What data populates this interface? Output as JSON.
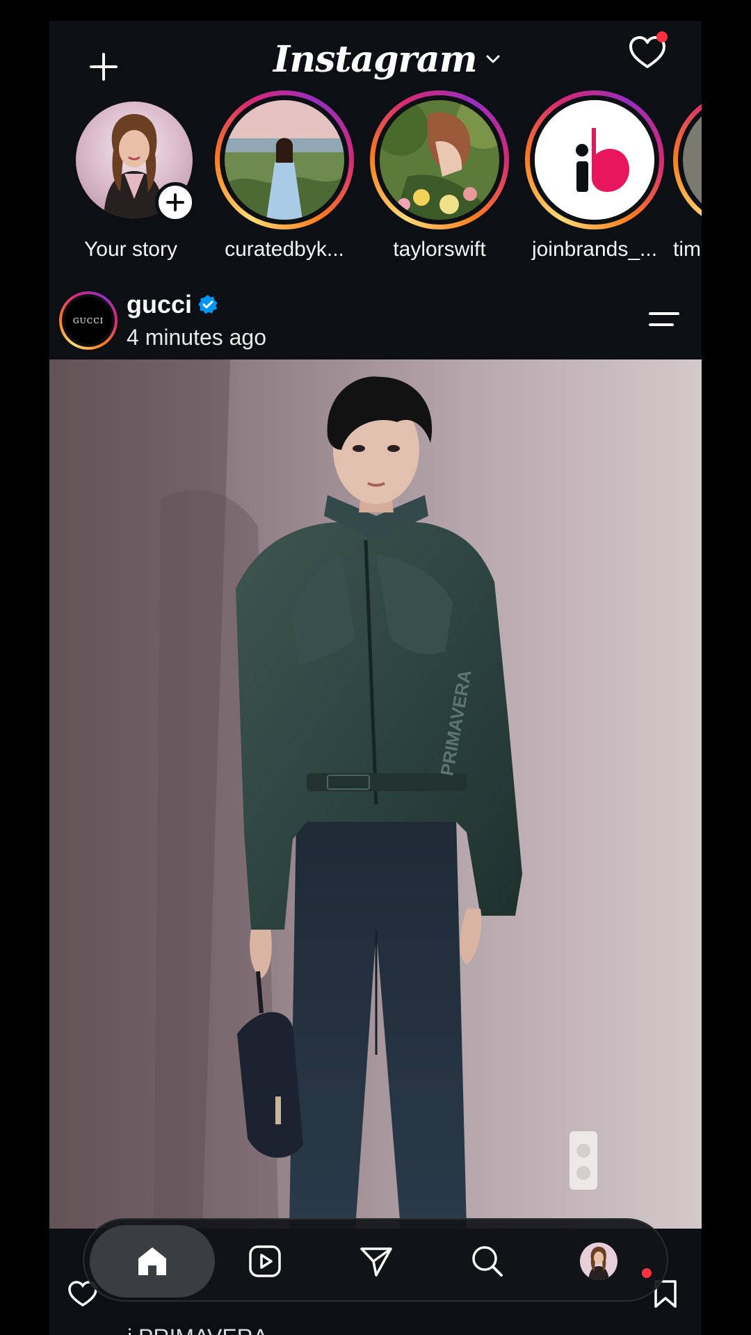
{
  "app": {
    "title": "Instagram"
  },
  "stories": [
    {
      "label": "Your story",
      "own": true
    },
    {
      "label": "curatedbyk..."
    },
    {
      "label": "taylorswift"
    },
    {
      "label": "joinbrands_..."
    },
    {
      "label": "tim"
    }
  ],
  "post": {
    "username": "gucci",
    "avatar_text": "GUCCI",
    "time": "4 minutes ago",
    "jacket_text": "PRIMAVERA",
    "caption_peek": "i PRIMAVERA"
  },
  "nav": {
    "items": [
      "home",
      "reels",
      "messages",
      "search",
      "profile"
    ],
    "active": "home"
  },
  "colors": {
    "background": "#0c1014",
    "accent_red": "#ff3040",
    "verified_blue": "#0095f6"
  }
}
